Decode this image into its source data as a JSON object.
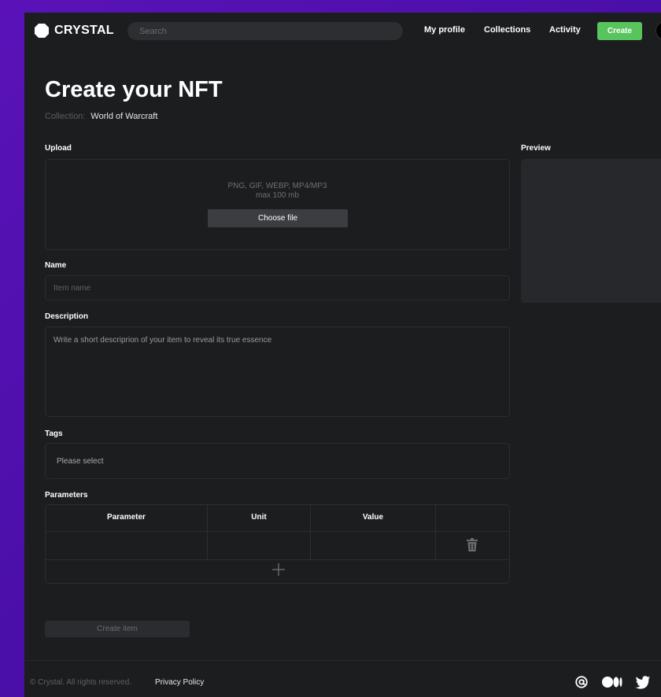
{
  "header": {
    "brand": "CRYSTAL",
    "search_placeholder": "Search",
    "nav": {
      "profile": "My profile",
      "collections": "Collections",
      "activity": "Activity"
    },
    "create_label": "Create"
  },
  "page": {
    "title": "Create your NFT",
    "collection_label": "Collection:",
    "collection_value": "World of Warcraft"
  },
  "upload": {
    "label": "Upload",
    "formats": "PNG, GIF, WEBP, MP4/MP3",
    "max_size": "max 100 mb",
    "choose_label": "Choose file"
  },
  "preview": {
    "label": "Preview"
  },
  "name": {
    "label": "Name",
    "placeholder": "Item name"
  },
  "description": {
    "label": "Description",
    "placeholder": "Write a short descriprion of your item to reveal its true essence"
  },
  "tags": {
    "label": "Tags",
    "placeholder": "Please select"
  },
  "parameters": {
    "label": "Parameters",
    "columns": [
      "Parameter",
      "Unit",
      "Value"
    ]
  },
  "create_item_label": "Create item",
  "footer": {
    "copyright": "© Crystal. All rights reserved.",
    "privacy": "Privacy Policy"
  },
  "colors": {
    "accent_green": "#58c45e",
    "background": "#1c1d1f",
    "border": "#2b2d30",
    "outer_purple": "#4a0fa8"
  },
  "icons": [
    "logo-icon",
    "trash-icon",
    "plus-icon",
    "email-icon",
    "medium-icon",
    "twitter-icon"
  ]
}
